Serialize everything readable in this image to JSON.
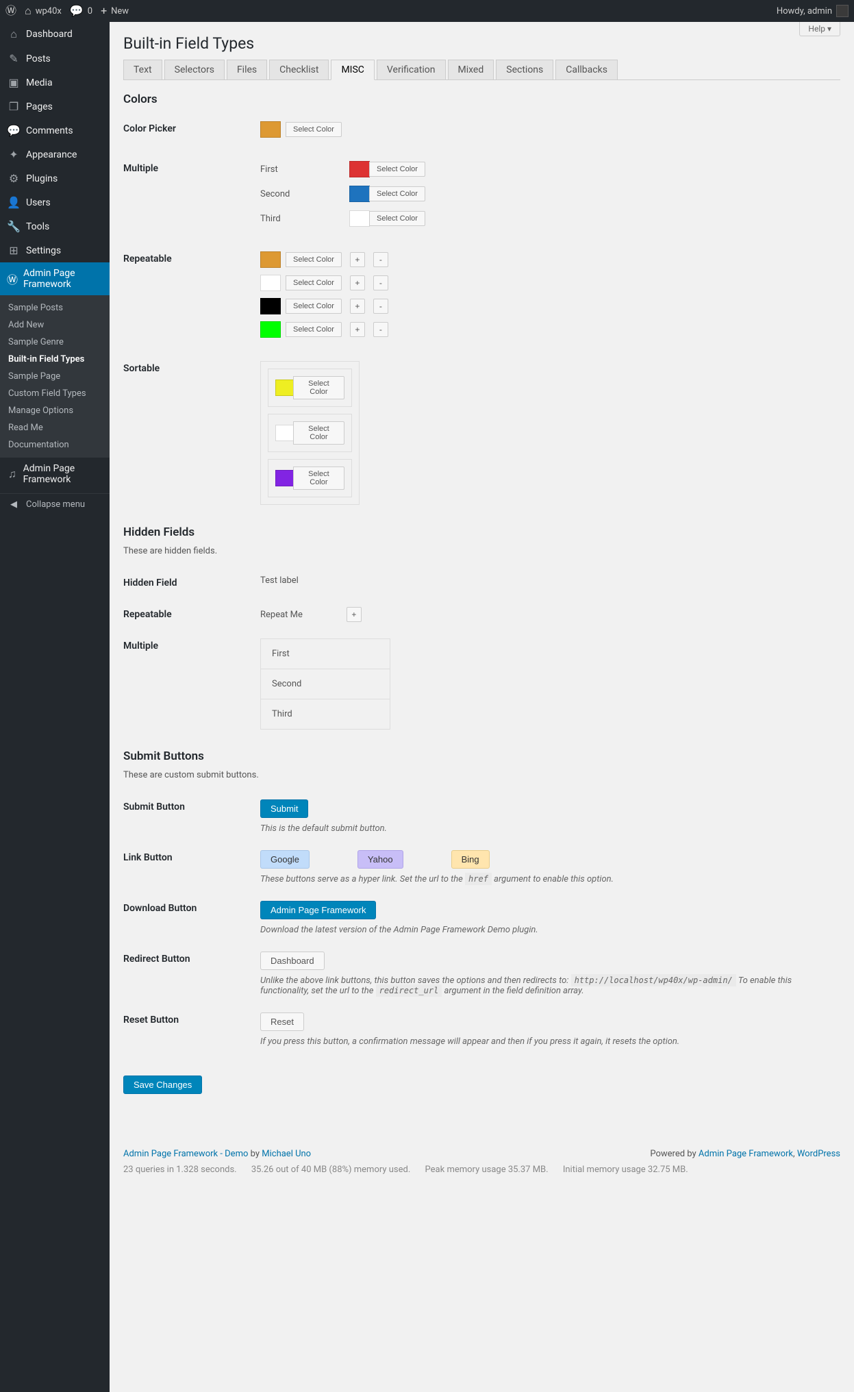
{
  "adminbar": {
    "site_name": "wp40x",
    "comments": "0",
    "new": "New",
    "howdy": "Howdy, admin"
  },
  "help": "Help ▾",
  "sidebar": {
    "items": [
      {
        "icon": "⌂",
        "label": "Dashboard"
      },
      {
        "icon": "✎",
        "label": "Posts"
      },
      {
        "icon": "▣",
        "label": "Media"
      },
      {
        "icon": "❐",
        "label": "Pages"
      },
      {
        "icon": "💬",
        "label": "Comments"
      },
      {
        "icon": "✦",
        "label": "Appearance"
      },
      {
        "icon": "⚙",
        "label": "Plugins"
      },
      {
        "icon": "👤",
        "label": "Users"
      },
      {
        "icon": "🔧",
        "label": "Tools"
      },
      {
        "icon": "⊞",
        "label": "Settings"
      },
      {
        "icon": "Ⓦ",
        "label": "Admin Page Framework"
      }
    ],
    "submenu": [
      "Sample Posts",
      "Add New",
      "Sample Genre",
      "Built-in Field Types",
      "Sample Page",
      "Custom Field Types",
      "Manage Options",
      "Read Me",
      "Documentation"
    ],
    "secondary": {
      "icon": "♫",
      "label": "Admin Page Framework"
    },
    "collapse": "Collapse menu"
  },
  "page_title": "Built-in Field Types",
  "tabs": [
    "Text",
    "Selectors",
    "Files",
    "Checklist",
    "MISC",
    "Verification",
    "Mixed",
    "Sections",
    "Callbacks"
  ],
  "tabs_active": 4,
  "sections": {
    "colors": {
      "title": "Colors",
      "picker_label": "Color Picker",
      "select_color": "Select Color",
      "single_color": "#DD9933",
      "multiple_label": "Multiple",
      "multiple": [
        {
          "label": "First",
          "color": "#DD3333"
        },
        {
          "label": "Second",
          "color": "#1E73BE"
        },
        {
          "label": "Third",
          "color": "#FFFFFF"
        }
      ],
      "repeatable_label": "Repeatable",
      "repeatable": [
        "#DD9933",
        "#FFFFFF",
        "#000000",
        "#00FF00"
      ],
      "sortable_label": "Sortable",
      "sortable": [
        "#EEEE22",
        "#FFFFFF",
        "#8224E3"
      ]
    },
    "hidden": {
      "title": "Hidden Fields",
      "desc": "These are hidden fields.",
      "field_label": "Hidden Field",
      "field_value": "Test label",
      "repeatable_label": "Repeatable",
      "repeatable_value": "Repeat Me",
      "multiple_label": "Multiple",
      "multiple": [
        "First",
        "Second",
        "Third"
      ]
    },
    "submit": {
      "title": "Submit Buttons",
      "desc": "These are custom submit buttons.",
      "button_label": "Submit Button",
      "button_text": "Submit",
      "button_desc": "This is the default submit button.",
      "link_label": "Link Button",
      "links": [
        "Google",
        "Yahoo",
        "Bing"
      ],
      "link_desc_pre": "These buttons serve as a hyper link. Set the url to the ",
      "link_code": "href",
      "link_desc_post": " argument to enable this option.",
      "download_label": "Download Button",
      "download_text": "Admin Page Framework",
      "download_desc": "Download the latest version of the Admin Page Framework Demo plugin.",
      "redirect_label": "Redirect Button",
      "redirect_text": "Dashboard",
      "redirect_desc_pre": "Unlike the above link buttons, this button saves the options and then redirects to: ",
      "redirect_code1": "http://localhost/wp40x/wp-admin/",
      "redirect_desc_mid": " To enable this functionality, set the url to the ",
      "redirect_code2": "redirect_url",
      "redirect_desc_post": " argument in the field definition array.",
      "reset_label": "Reset Button",
      "reset_text": "Reset",
      "reset_desc": "If you press this button, a confirmation message will appear and then if you press it again, it resets the option."
    }
  },
  "save": "Save Changes",
  "footer": {
    "left_link": "Admin Page Framework - Demo",
    "by": " by ",
    "author": "Michael Uno",
    "right_pre": "Powered by ",
    "right_link1": "Admin Page Framework",
    "right_sep": ", ",
    "right_link2": "WordPress",
    "stats": [
      "23 queries in 1.328 seconds.",
      "35.26 out of 40 MB (88%) memory used.",
      "Peak memory usage 35.37 MB.",
      "Initial memory usage 32.75 MB."
    ]
  }
}
